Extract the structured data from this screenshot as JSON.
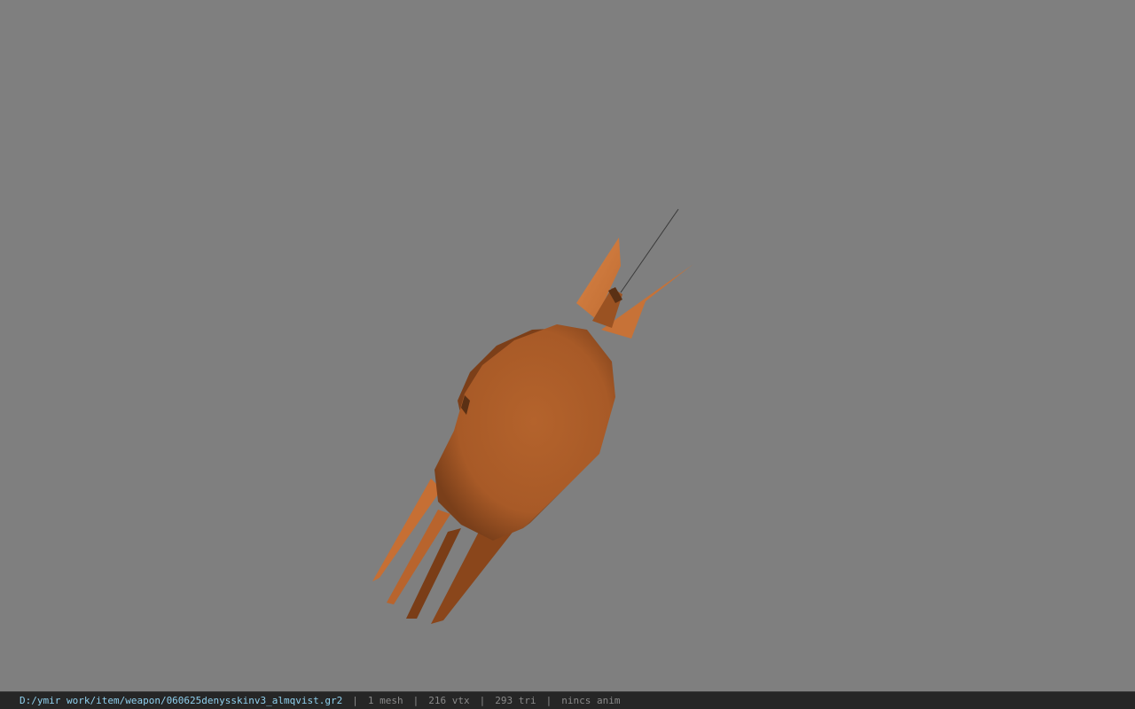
{
  "viewer": {
    "background_color": "#7f7f7f",
    "model_color": "#b0622b",
    "fin_color": "#d27a3c"
  },
  "status": {
    "file_path": "D:/ymir work/item/weapon/060625denysskinv3_almqvist.gr2",
    "separator": "|",
    "mesh": "1 mesh",
    "vtx": "216 vtx",
    "tri": "293 tri",
    "anim": "nincs anim"
  }
}
